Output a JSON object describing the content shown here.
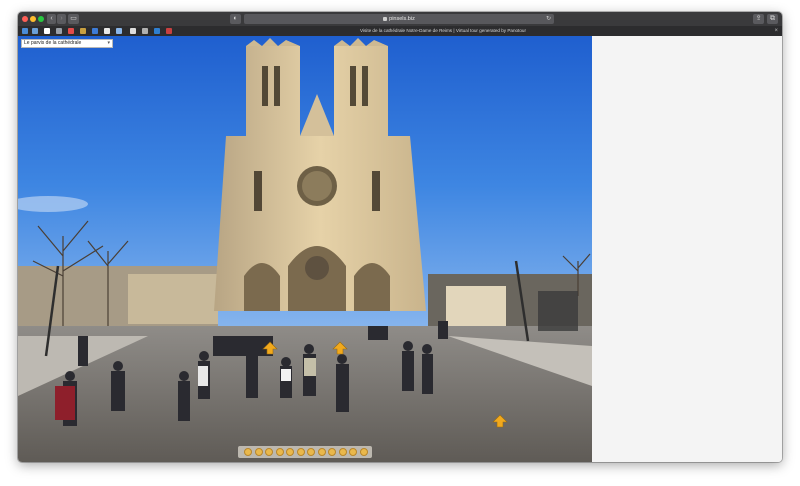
{
  "browser": {
    "url": "pinsels.biz",
    "tab_title": "Visite de la cathédrale Notre-Dame de Reims | Virtual tour generated by Panotour",
    "tab_close": "×"
  },
  "bookmarks": [
    {
      "name": "bookmark-1",
      "color": "#4a8cd8"
    },
    {
      "name": "bookmark-2",
      "color": "#6aa0d8"
    },
    {
      "name": "bookmark-3",
      "color": "#ffffff"
    },
    {
      "name": "bookmark-4",
      "color": "#9aa0a8"
    },
    {
      "name": "bookmark-5",
      "color": "#e34b4b"
    },
    {
      "name": "bookmark-6",
      "color": "#c8a040"
    },
    {
      "name": "bookmark-7",
      "color": "#3d7bd6"
    },
    {
      "name": "bookmark-8",
      "color": "#e8e8e8"
    },
    {
      "name": "bookmark-9",
      "color": "#8ab6ea"
    },
    {
      "name": "bookmark-10",
      "color": "#dddddd"
    },
    {
      "name": "bookmark-11",
      "color": "#b0b0b0"
    },
    {
      "name": "bookmark-12",
      "color": "#2f7fd0"
    },
    {
      "name": "bookmark-13",
      "color": "#c84040"
    }
  ],
  "tour": {
    "scene_select_value": "Le parvis de la cathédrale",
    "hotspot_color": "#f1a91d",
    "controls": [
      "zoom-out-icon",
      "zoom-in-icon",
      "arrow-up-icon",
      "arrow-down-icon",
      "arrow-left-icon",
      "arrow-right-icon",
      "autorotate-icon",
      "fullscreen-icon",
      "gyro-icon",
      "help-icon",
      "info-icon",
      "map-icon"
    ]
  }
}
